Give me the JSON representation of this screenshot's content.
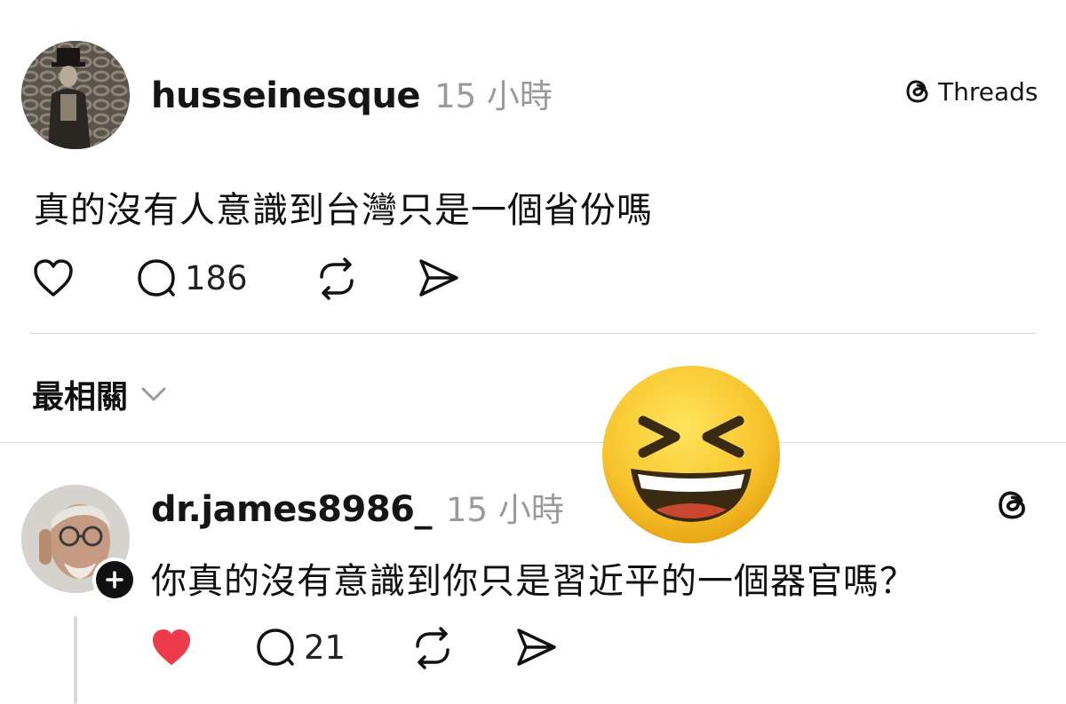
{
  "post": {
    "username": "husseinesque",
    "time": "15 小時",
    "text": "真的沒有人意識到台灣只是一個省份嗎",
    "reply_count": "186",
    "brand_label": "Threads"
  },
  "sort": {
    "label": "最相關"
  },
  "reply": {
    "username": "dr.james8986_",
    "time": "15 小時",
    "text": "你真的沒有意識到你只是習近平的一個器官嗎？",
    "reply_count": "21",
    "liked": true
  },
  "colors": {
    "like_active": "#ee3b4b",
    "time_gray": "#9a9a9a",
    "divider": "#d9d9d9",
    "emoji_face": "#f7c42c"
  },
  "icons": [
    "heart-icon",
    "comment-icon",
    "repost-icon",
    "share-icon",
    "threads-logo-icon",
    "chevron-down-icon",
    "plus-icon",
    "grinning-squinting-emoji"
  ]
}
